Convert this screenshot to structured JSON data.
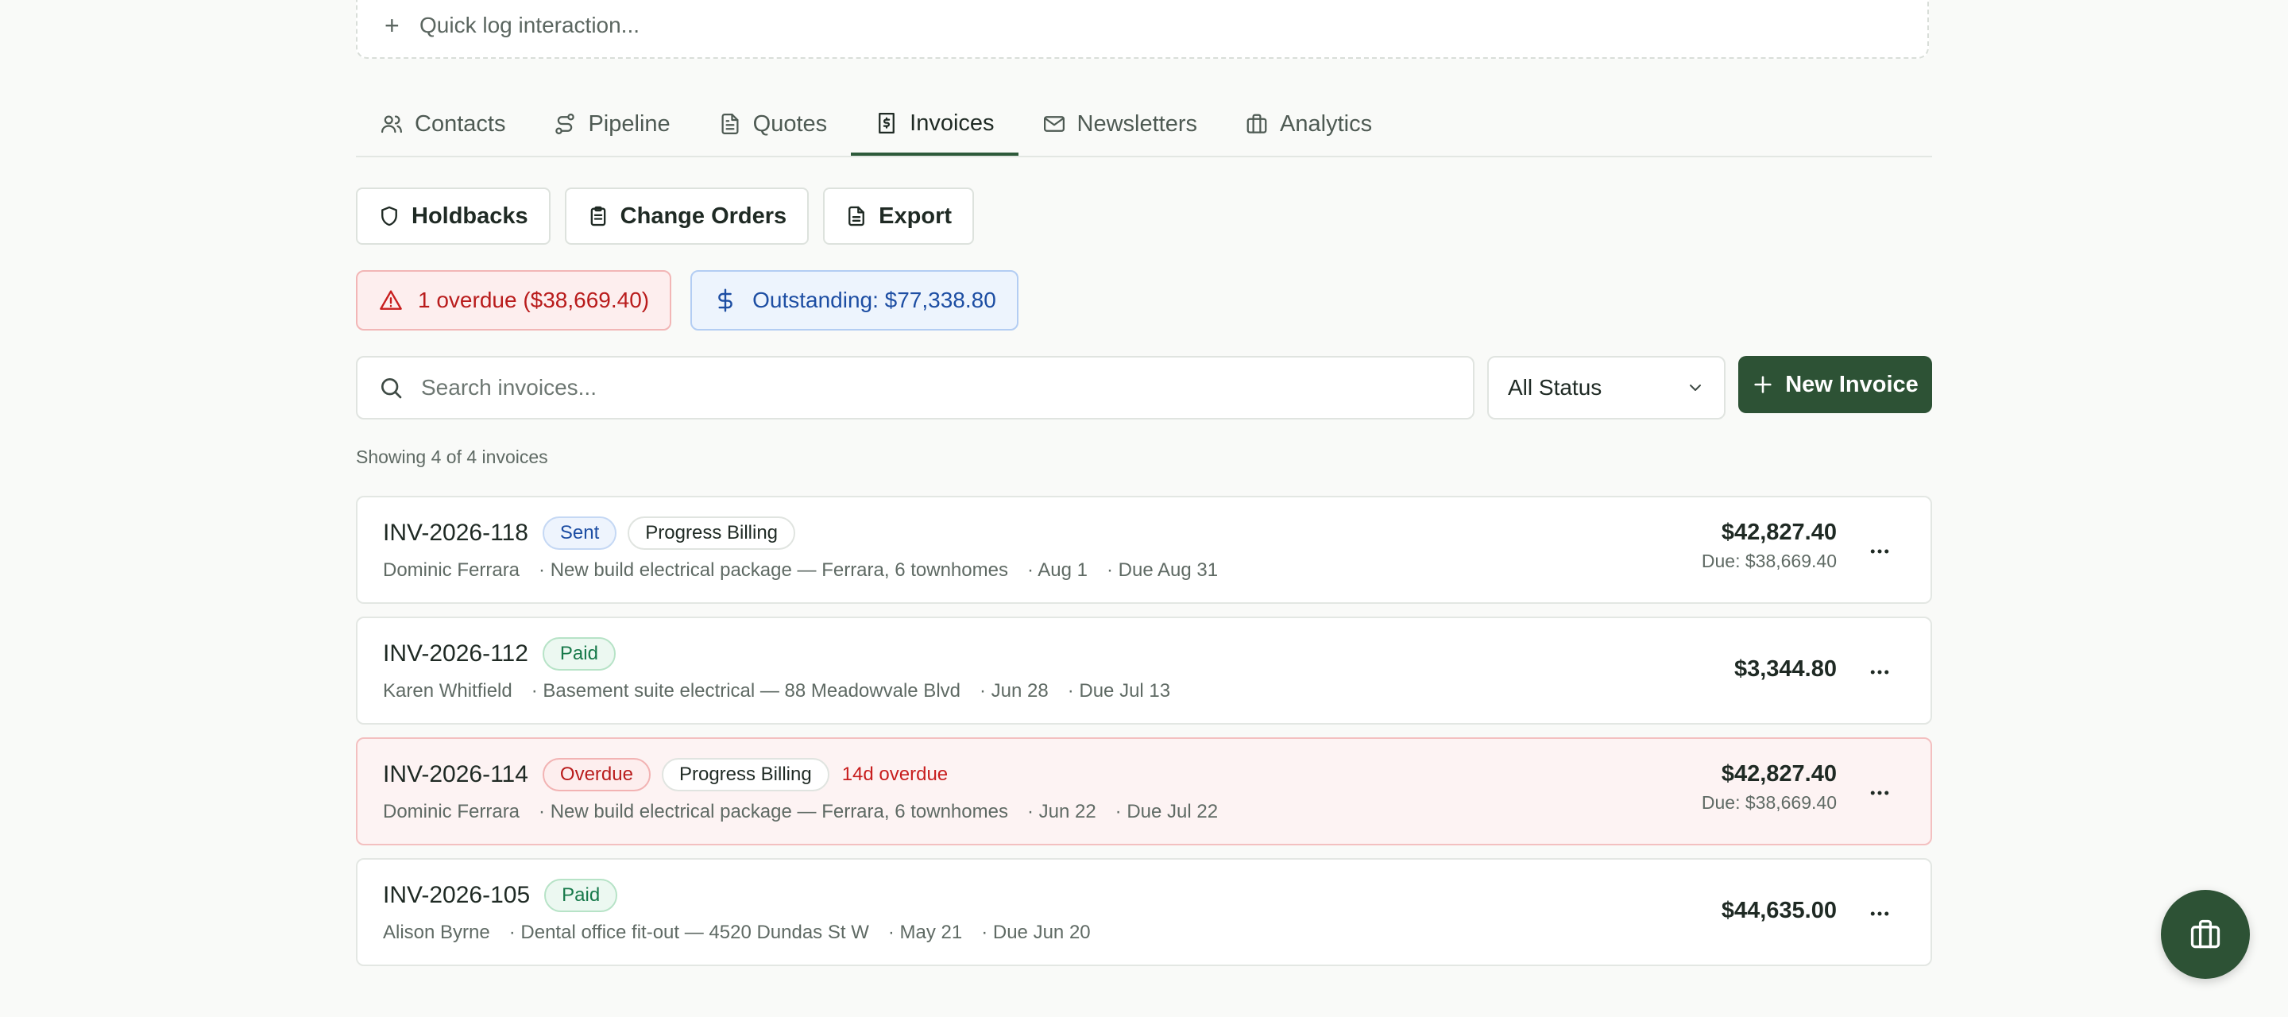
{
  "quick_log": {
    "placeholder": "Quick log interaction..."
  },
  "tabs": [
    {
      "label": "Contacts",
      "icon": "users-icon"
    },
    {
      "label": "Pipeline",
      "icon": "route-icon"
    },
    {
      "label": "Quotes",
      "icon": "document-icon"
    },
    {
      "label": "Invoices",
      "icon": "invoice-icon",
      "active": true
    },
    {
      "label": "Newsletters",
      "icon": "mail-icon"
    },
    {
      "label": "Analytics",
      "icon": "briefcase-icon"
    }
  ],
  "actions": {
    "holdbacks": "Holdbacks",
    "change_orders": "Change Orders",
    "export": "Export"
  },
  "alerts": {
    "overdue": "1 overdue ($38,669.40)",
    "outstanding": "Outstanding: $77,338.80"
  },
  "search": {
    "placeholder": "Search invoices..."
  },
  "filter": {
    "selected": "All Status"
  },
  "new_invoice": "New Invoice",
  "showing": "Showing 4 of 4 invoices",
  "invoices": [
    {
      "number": "INV-2026-118",
      "status": "Sent",
      "tag": "Progress Billing",
      "client": "Dominic Ferrara",
      "project": "· New build electrical package — Ferrara, 6 townhomes",
      "date": "· Aug 1",
      "due_date": "· Due Aug 31",
      "amount": "$42,827.40",
      "due": "Due: $38,669.40"
    },
    {
      "number": "INV-2026-112",
      "status": "Paid",
      "client": "Karen Whitfield",
      "project": "· Basement suite electrical — 88 Meadowvale Blvd",
      "date": "· Jun 28",
      "due_date": "· Due Jul 13",
      "amount": "$3,344.80"
    },
    {
      "number": "INV-2026-114",
      "status": "Overdue",
      "tag": "Progress Billing",
      "overdue_note": "14d overdue",
      "client": "Dominic Ferrara",
      "project": "· New build electrical package — Ferrara, 6 townhomes",
      "date": "· Jun 22",
      "due_date": "· Due Jul 22",
      "amount": "$42,827.40",
      "due": "Due: $38,669.40"
    },
    {
      "number": "INV-2026-105",
      "status": "Paid",
      "client": "Alison Byrne",
      "project": "· Dental office fit-out — 4520 Dundas St W",
      "date": "· May 21",
      "due_date": "· Due Jun 20",
      "amount": "$44,635.00"
    }
  ],
  "colors": {
    "brand": "#2d5235",
    "overdue": "#b91c1c",
    "info": "#1d4ea3",
    "paid": "#17794a"
  }
}
